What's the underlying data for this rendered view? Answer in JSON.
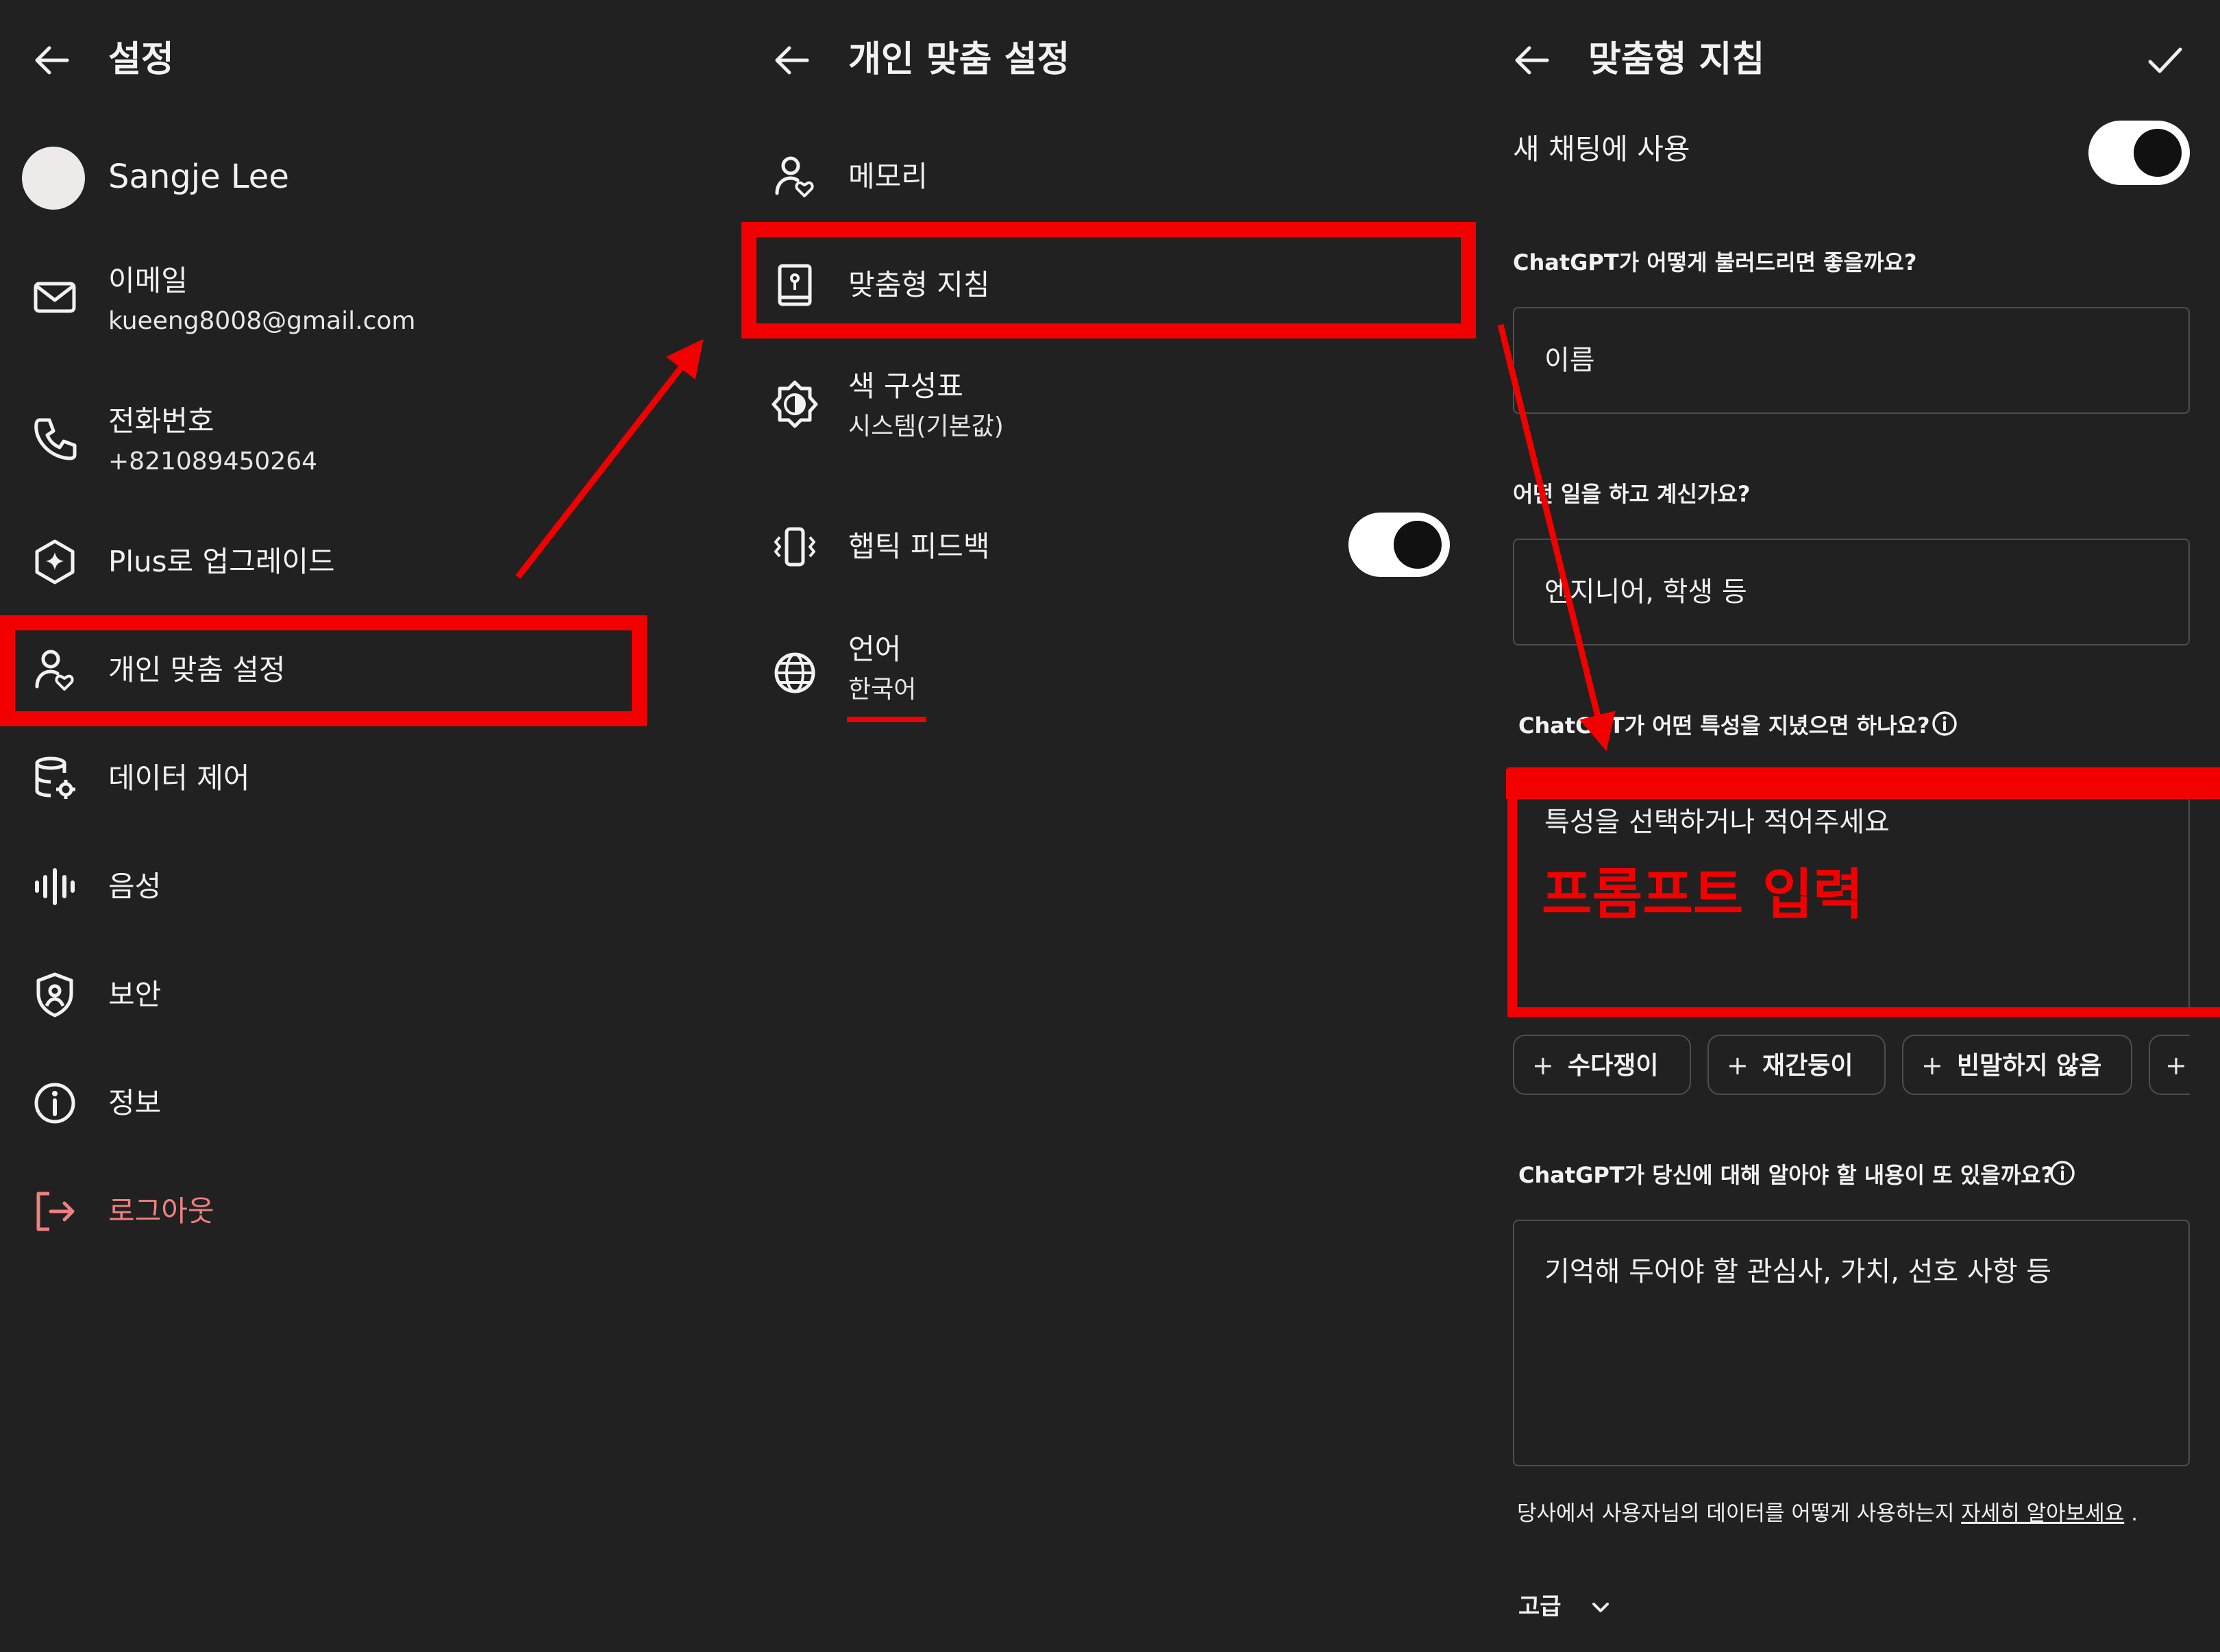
{
  "settings": {
    "title": "설정",
    "profile": {
      "name": "Sangje Lee"
    },
    "email": {
      "label": "이메일",
      "value": "kueeng8008@gmail.com"
    },
    "phone": {
      "label": "전화번호",
      "value": "+821089450264"
    },
    "menu": {
      "upgrade": "Plus로 업그레이드",
      "personalization": "개인 맞춤 설정",
      "data_controls": "데이터 제어",
      "voice": "음성",
      "security": "보안",
      "about": "정보",
      "logout": "로그아웃"
    }
  },
  "personalization": {
    "title": "개인 맞춤 설정",
    "memory": "메모리",
    "custom_instructions": "맞춤형 지침",
    "color_scheme": {
      "label": "색 구성표",
      "value": "시스템(기본값)"
    },
    "haptic": {
      "label": "햅틱 피드백",
      "enabled": true
    },
    "language": {
      "label": "언어",
      "value": "한국어"
    }
  },
  "custom_instructions": {
    "title": "맞춤형 지침",
    "new_chats": {
      "label": "새 채팅에 사용",
      "enabled": true
    },
    "q_name": "ChatGPT가 어떻게 불러드리면 좋을까요?",
    "name_placeholder": "이름",
    "q_job": "어떤 일을 하고 계신가요?",
    "job_placeholder": "엔지니어, 학생 등",
    "q_traits": "ChatGPT가 어떤 특성을 지녔으면 하나요?",
    "traits_placeholder": "특성을 선택하거나 적어주세요",
    "annotation": "프롬프트 입력",
    "chips": [
      "수다쟁이",
      "재간둥이",
      "빈말하지 않음",
      "+"
    ],
    "q_more": "ChatGPT가 당신에 대해 알아야 할 내용이 또 있을까요?",
    "more_placeholder": "기억해 두어야 할 관심사, 가치, 선호 사항 등",
    "footer_text": "당사에서 사용자님의 데이터를 어떻게 사용하는지",
    "footer_link": "자세히 알아보세요",
    "footer_period": ".",
    "advanced": "고급"
  },
  "colors": {
    "background": "#212121",
    "annotation_red": "#f20000",
    "logout_red": "#f08080"
  }
}
